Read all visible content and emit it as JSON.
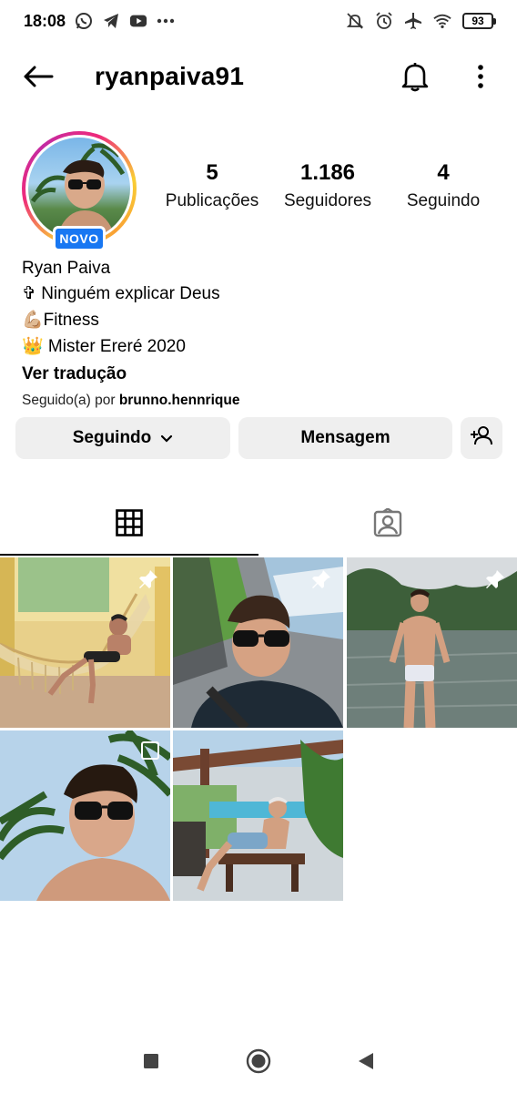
{
  "status_bar": {
    "time": "18:08",
    "left_icons": [
      "whatsapp-icon",
      "telegram-icon",
      "youtube-icon",
      "more-dots-icon"
    ],
    "right_icons": [
      "bell-muted-icon",
      "alarm-icon",
      "airplane-icon",
      "wifi-icon"
    ],
    "battery": "93"
  },
  "header": {
    "username": "ryanpaiva91"
  },
  "profile": {
    "badge": "NOVO",
    "stats": [
      {
        "value": "5",
        "label": "Publicações"
      },
      {
        "value": "1.186",
        "label": "Seguidores"
      },
      {
        "value": "4",
        "label": "Seguindo"
      }
    ],
    "name": "Ryan Paiva",
    "bio_lines": [
      "✞ Ninguém explicar Deus",
      "💪🏼Fitness",
      "👑 Mister Ereré 2020"
    ],
    "translate": "Ver tradução",
    "followed_by_prefix": "Seguido(a) por ",
    "followed_by_user": "brunno.hennrique"
  },
  "actions": {
    "following": "Seguindo",
    "message": "Mensagem"
  },
  "tabs": [
    "grid-icon",
    "tagged-icon"
  ],
  "posts": [
    {
      "id": "post-1",
      "scene": "hammock",
      "pinned": true
    },
    {
      "id": "post-2",
      "scene": "car-selfie",
      "pinned": true
    },
    {
      "id": "post-3",
      "scene": "river",
      "pinned": true
    },
    {
      "id": "post-4",
      "scene": "palm-selfie",
      "multi": true
    },
    {
      "id": "post-5",
      "scene": "pool"
    }
  ],
  "nav": [
    "recent-apps-icon",
    "home-icon",
    "back-icon"
  ]
}
